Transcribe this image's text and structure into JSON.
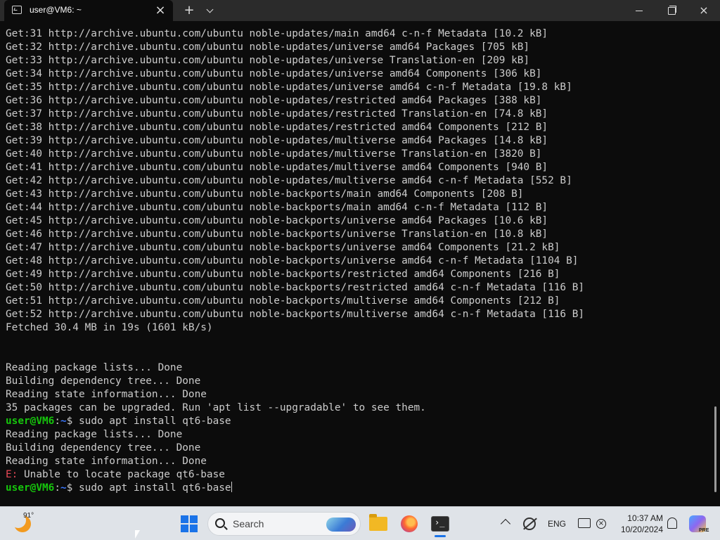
{
  "window": {
    "tab_title": "user@VM6: ~",
    "close_tab_glyph": "×",
    "new_tab_glyph": "+",
    "close_window_glyph": "×"
  },
  "terminal": {
    "lines": [
      "Get:31 http://archive.ubuntu.com/ubuntu noble-updates/main amd64 c-n-f Metadata [10.2 kB]",
      "Get:32 http://archive.ubuntu.com/ubuntu noble-updates/universe amd64 Packages [705 kB]",
      "Get:33 http://archive.ubuntu.com/ubuntu noble-updates/universe Translation-en [209 kB]",
      "Get:34 http://archive.ubuntu.com/ubuntu noble-updates/universe amd64 Components [306 kB]",
      "Get:35 http://archive.ubuntu.com/ubuntu noble-updates/universe amd64 c-n-f Metadata [19.8 kB]",
      "Get:36 http://archive.ubuntu.com/ubuntu noble-updates/restricted amd64 Packages [388 kB]",
      "Get:37 http://archive.ubuntu.com/ubuntu noble-updates/restricted Translation-en [74.8 kB]",
      "Get:38 http://archive.ubuntu.com/ubuntu noble-updates/restricted amd64 Components [212 B]",
      "Get:39 http://archive.ubuntu.com/ubuntu noble-updates/multiverse amd64 Packages [14.8 kB]",
      "Get:40 http://archive.ubuntu.com/ubuntu noble-updates/multiverse Translation-en [3820 B]",
      "Get:41 http://archive.ubuntu.com/ubuntu noble-updates/multiverse amd64 Components [940 B]",
      "Get:42 http://archive.ubuntu.com/ubuntu noble-updates/multiverse amd64 c-n-f Metadata [552 B]",
      "Get:43 http://archive.ubuntu.com/ubuntu noble-backports/main amd64 Components [208 B]",
      "Get:44 http://archive.ubuntu.com/ubuntu noble-backports/main amd64 c-n-f Metadata [112 B]",
      "Get:45 http://archive.ubuntu.com/ubuntu noble-backports/universe amd64 Packages [10.6 kB]",
      "Get:46 http://archive.ubuntu.com/ubuntu noble-backports/universe Translation-en [10.8 kB]",
      "Get:47 http://archive.ubuntu.com/ubuntu noble-backports/universe amd64 Components [21.2 kB]",
      "Get:48 http://archive.ubuntu.com/ubuntu noble-backports/universe amd64 c-n-f Metadata [1104 B]",
      "Get:49 http://archive.ubuntu.com/ubuntu noble-backports/restricted amd64 Components [216 B]",
      "Get:50 http://archive.ubuntu.com/ubuntu noble-backports/restricted amd64 c-n-f Metadata [116 B]",
      "Get:51 http://archive.ubuntu.com/ubuntu noble-backports/multiverse amd64 Components [212 B]",
      "Get:52 http://archive.ubuntu.com/ubuntu noble-backports/multiverse amd64 c-n-f Metadata [116 B]",
      "Fetched 30.4 MB in 19s (1601 kB/s)",
      "",
      "",
      "Reading package lists... Done",
      "Building dependency tree... Done",
      "Reading state information... Done",
      "35 packages can be upgraded. Run 'apt list --upgradable' to see them."
    ],
    "prompt_user": "user@VM6",
    "prompt_colon": ":",
    "prompt_path": "~",
    "prompt_dollar": "$",
    "command1": " sudo apt install qt6-base",
    "after_command": [
      "Reading package lists... Done",
      "Building dependency tree... Done",
      "Reading state information... Done"
    ],
    "error_prefix": "E:",
    "error_message": " Unable to locate package qt6-base",
    "command2": " sudo apt install qt6-base"
  },
  "taskbar": {
    "temperature": "91°",
    "search_placeholder": "Search",
    "language": "ENG",
    "time": "10:37 AM",
    "date": "10/20/2024",
    "copilot_badge": "PRE",
    "icons": [
      "weather-icon",
      "windows-start-icon",
      "search-icon",
      "file-explorer-icon",
      "firefox-icon",
      "terminal-icon",
      "chevron-up-icon",
      "network-off-icon",
      "display-icon",
      "mute-icon",
      "notification-bell-icon",
      "copilot-icon"
    ]
  },
  "colors": {
    "terminal_bg": "#0c0c0c",
    "terminal_text": "#cccccc",
    "prompt_user": "#16c60c",
    "prompt_path": "#3b78ff",
    "error": "#e74856",
    "titlebar": "#2b2b2b",
    "taskbar": "#dfe3e8"
  }
}
